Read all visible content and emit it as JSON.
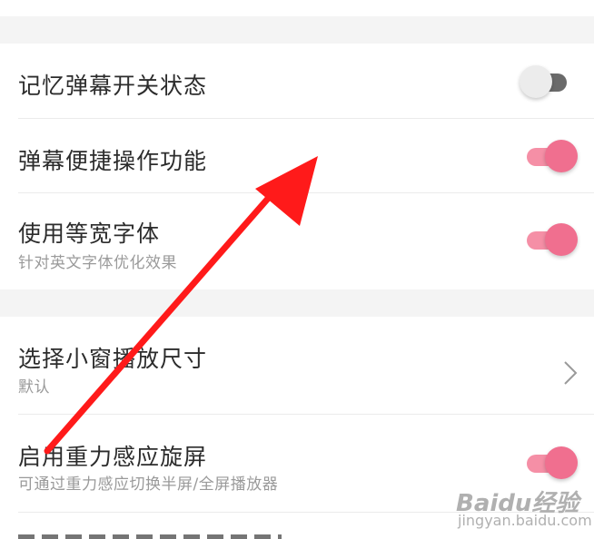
{
  "settings_group_1": [
    {
      "title": "记忆弹幕开关状态",
      "toggle": "off"
    },
    {
      "title": "弹幕便捷操作功能",
      "toggle": "on"
    },
    {
      "title": "使用等宽字体",
      "subtitle": "针对英文字体优化效果",
      "toggle": "on"
    }
  ],
  "settings_group_2": [
    {
      "title": "选择小窗播放尺寸",
      "subtitle": "默认",
      "control": "chevron-right-icon"
    },
    {
      "title": "启用重力感应旋屏",
      "subtitle": "可通过重力感应切换半屏/全屏播放器",
      "toggle": "on"
    }
  ],
  "watermark": {
    "brand": "Baidu经验",
    "url": "jingyan.baidu.com"
  },
  "colors": {
    "toggle_on_knob": "#f06f8f",
    "toggle_on_track": "#f58fa6",
    "toggle_off_knob": "#ececec",
    "toggle_off_track": "#6a6a6a",
    "annotation_arrow": "#ff1a1a",
    "section_gap": "#f4f4f4"
  },
  "icons": [
    "chevron-right-icon",
    "annotation-arrow-icon",
    "baidu-paw-icon"
  ]
}
